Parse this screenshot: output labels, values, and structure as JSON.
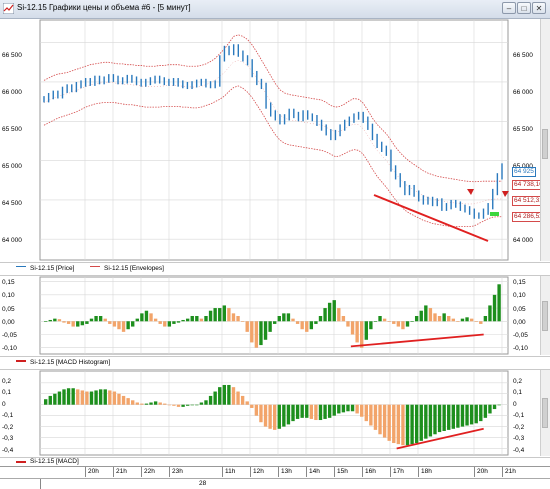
{
  "window": {
    "title": "Si-12.15 Графики цены и объема #6 - [5 минут]",
    "minimize_label": "–",
    "maximize_label": "□",
    "close_label": "✕",
    "icon": "chart-app-icon"
  },
  "colors": {
    "price_bar": "#2a79bd",
    "envelope": "#d44a4a",
    "hist_pos": "#1d8f1d",
    "hist_neg": "#f2a46a",
    "trend_line": "#e02020",
    "grid": "#d8d8d8"
  },
  "price_pane": {
    "y_ticks": [
      "66 500",
      "66 000",
      "65 500",
      "65 000",
      "64 500",
      "64 000"
    ],
    "last_price": "64 925",
    "envelope_upper": "64 738,106",
    "envelope_mid": "64 512,313",
    "envelope_lower": "64 286,520",
    "legend": [
      {
        "label": "Si-12.15 [Price]",
        "color": "#2a79bd"
      },
      {
        "label": "Si-12.15 [Envelopes]",
        "color": "#d44a4a"
      }
    ]
  },
  "hist_pane": {
    "y_ticks": [
      "0,15",
      "0,10",
      "0,05",
      "0,00",
      "-0,05",
      "-0,10"
    ],
    "legend": [
      {
        "label": "Si-12.15 [MACD Histogram]",
        "color": "#d02020"
      }
    ]
  },
  "macd_pane": {
    "y_ticks": [
      "0,2",
      "0,1",
      "0",
      "-0,1",
      "-0,2",
      "-0,3",
      "-0,4"
    ],
    "legend": [
      {
        "label": "Si-12.15 [MACD]",
        "color": "#d02020"
      }
    ]
  },
  "time_axis": {
    "hours": [
      "20h",
      "21h",
      "22h",
      "23h",
      "11h",
      "12h",
      "13h",
      "14h",
      "15h",
      "16h",
      "17h",
      "18h",
      "20h",
      "21h"
    ],
    "date": "28"
  },
  "chart_data": [
    {
      "type": "line",
      "name": "Si-12.15 [Price]",
      "ylim": [
        63850,
        66750
      ],
      "close": [
        65780,
        65820,
        65850,
        65830,
        65900,
        65930,
        65910,
        65960,
        65980,
        66010,
        65990,
        66040,
        66010,
        66030,
        66060,
        66040,
        66010,
        66020,
        66050,
        66030,
        66000,
        65980,
        66000,
        66020,
        66040,
        66020,
        66000,
        65990,
        66010,
        65980,
        65960,
        65950,
        65970,
        65990,
        66000,
        65970,
        65960,
        65980,
        66300,
        66420,
        66380,
        66440,
        66360,
        66300,
        66250,
        66100,
        66000,
        65950,
        65700,
        65600,
        65550,
        65500,
        65550,
        65620,
        65580,
        65540,
        65600,
        65560,
        65540,
        65480,
        65420,
        65360,
        65300,
        65350,
        65420,
        65480,
        65520,
        65560,
        65580,
        65520,
        65430,
        65300,
        65200,
        65150,
        65100,
        64900,
        64800,
        64700,
        64600,
        64650,
        64580,
        64520,
        64480,
        64500,
        64460,
        64480,
        64400,
        64420,
        64460,
        64440,
        64400,
        64380,
        64350,
        64300,
        64300,
        64350,
        64420,
        64600,
        64800,
        64925
      ],
      "envelope_upper": [
        66020,
        66050,
        66080,
        66100,
        66110,
        66120,
        66140,
        66160,
        66180,
        66200,
        66220,
        66230,
        66240,
        66250,
        66250,
        66240,
        66230,
        66230,
        66220,
        66220,
        66210,
        66210,
        66200,
        66200,
        66200,
        66210,
        66210,
        66220,
        66220,
        66220,
        66210,
        66200,
        66200,
        66200,
        66210,
        66230,
        66260,
        66300,
        66360,
        66420,
        66500,
        66580,
        66600,
        66580,
        66540,
        66470,
        66380,
        66280,
        66180,
        66080,
        65980,
        65900,
        65860,
        65840,
        65830,
        65820,
        65810,
        65800,
        65790,
        65780,
        65770,
        65740,
        65700,
        65680,
        65690,
        65720,
        65760,
        65790,
        65780,
        65730,
        65640,
        65540,
        65460,
        65400,
        65340,
        65260,
        65170,
        65100,
        65040,
        64990,
        64950,
        64910,
        64870,
        64840,
        64820,
        64800,
        64790,
        64780,
        64770,
        64760,
        64750,
        64740,
        64735,
        64730,
        64735,
        64738,
        64738,
        64738,
        64738,
        64738
      ],
      "envelope_lower": [
        65450,
        65480,
        65510,
        65540,
        65560,
        65580,
        65600,
        65620,
        65650,
        65680,
        65700,
        65720,
        65730,
        65740,
        65740,
        65740,
        65730,
        65720,
        65710,
        65710,
        65700,
        65690,
        65680,
        65680,
        65680,
        65680,
        65690,
        65690,
        65690,
        65690,
        65680,
        65680,
        65670,
        65670,
        65680,
        65700,
        65720,
        65750,
        65780,
        65820,
        65880,
        65930,
        65950,
        65920,
        65870,
        65800,
        65710,
        65620,
        65520,
        65420,
        65330,
        65260,
        65220,
        65200,
        65190,
        65180,
        65170,
        65160,
        65150,
        65140,
        65130,
        65110,
        65080,
        65050,
        65060,
        65090,
        65120,
        65140,
        65130,
        65080,
        64990,
        64890,
        64800,
        64730,
        64660,
        64580,
        64500,
        64430,
        64370,
        64330,
        64300,
        64270,
        64240,
        64220,
        64200,
        64190,
        64180,
        64170,
        64160,
        64160,
        64160,
        64160,
        64160,
        64170,
        64200,
        64230,
        64260,
        64280,
        64286,
        64286
      ]
    },
    {
      "type": "bar",
      "name": "Si-12.15 [MACD Histogram]",
      "ylim": [
        -0.12,
        0.16
      ],
      "values": [
        0,
        0.005,
        0.01,
        0.008,
        -0.005,
        -0.01,
        -0.02,
        -0.02,
        -0.015,
        -0.01,
        0.01,
        0.02,
        0.02,
        0.01,
        -0.01,
        -0.02,
        -0.03,
        -0.04,
        -0.03,
        -0.02,
        0.01,
        0.03,
        0.04,
        0.03,
        0.01,
        -0.01,
        -0.02,
        -0.02,
        -0.01,
        -0.005,
        0.005,
        0.01,
        0.02,
        0.02,
        0.01,
        0.02,
        0.04,
        0.05,
        0.05,
        0.06,
        0.05,
        0.03,
        0.02,
        0.0,
        -0.04,
        -0.08,
        -0.1,
        -0.09,
        -0.07,
        -0.04,
        -0.01,
        0.02,
        0.03,
        0.03,
        0.01,
        -0.01,
        -0.03,
        -0.04,
        -0.03,
        -0.01,
        0.02,
        0.05,
        0.07,
        0.08,
        0.05,
        0.02,
        -0.02,
        -0.05,
        -0.08,
        -0.1,
        -0.07,
        -0.03,
        0.0,
        0.02,
        0.01,
        0.0,
        -0.01,
        -0.02,
        -0.03,
        -0.02,
        0.0,
        0.02,
        0.04,
        0.06,
        0.05,
        0.03,
        0.02,
        0.03,
        0.02,
        0.01,
        0.0,
        0.01,
        0.015,
        0.01,
        0.0,
        -0.01,
        0.02,
        0.06,
        0.1,
        0.14
      ],
      "trend_line": [
        {
          "x": 67,
          "y": -0.095
        },
        {
          "x": 96,
          "y": -0.05
        }
      ]
    },
    {
      "type": "bar",
      "name": "Si-12.15 [MACD]",
      "ylim": [
        -0.45,
        0.28
      ],
      "values": [
        0.05,
        0.08,
        0.1,
        0.12,
        0.14,
        0.15,
        0.15,
        0.14,
        0.13,
        0.12,
        0.12,
        0.13,
        0.14,
        0.14,
        0.13,
        0.12,
        0.1,
        0.08,
        0.06,
        0.04,
        0.02,
        0.01,
        0.01,
        0.02,
        0.03,
        0.02,
        0.01,
        0.0,
        -0.01,
        -0.02,
        -0.02,
        -0.01,
        0.0,
        0.0,
        0.02,
        0.04,
        0.08,
        0.12,
        0.16,
        0.18,
        0.18,
        0.16,
        0.12,
        0.08,
        0.03,
        -0.03,
        -0.1,
        -0.16,
        -0.2,
        -0.22,
        -0.23,
        -0.22,
        -0.2,
        -0.18,
        -0.15,
        -0.13,
        -0.12,
        -0.12,
        -0.13,
        -0.14,
        -0.14,
        -0.13,
        -0.12,
        -0.1,
        -0.08,
        -0.07,
        -0.06,
        -0.06,
        -0.08,
        -0.11,
        -0.15,
        -0.19,
        -0.23,
        -0.27,
        -0.3,
        -0.33,
        -0.35,
        -0.36,
        -0.37,
        -0.37,
        -0.36,
        -0.35,
        -0.33,
        -0.31,
        -0.29,
        -0.27,
        -0.25,
        -0.24,
        -0.23,
        -0.22,
        -0.21,
        -0.2,
        -0.19,
        -0.18,
        -0.17,
        -0.15,
        -0.12,
        -0.08,
        -0.04,
        0.0
      ],
      "trend_line": [
        {
          "x": 77,
          "y": -0.4
        },
        {
          "x": 96,
          "y": -0.22
        }
      ]
    }
  ]
}
